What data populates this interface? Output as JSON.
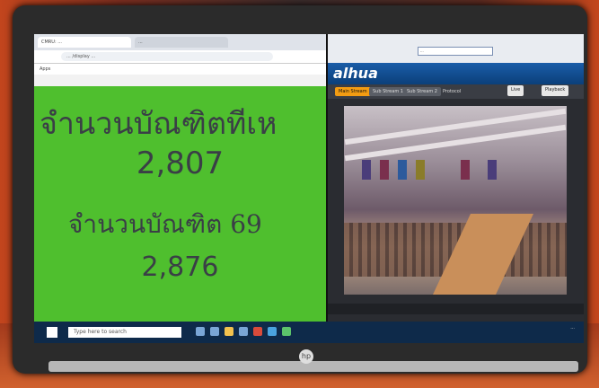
{
  "photo": {
    "subject": "laptop",
    "brand_logo": "hp"
  },
  "left_browser": {
    "tab1": "CMRU: ...",
    "tab2": "...",
    "url": "... /display ...",
    "bookmarks": "Apps"
  },
  "green_display": {
    "title1": "จำนวนบัณฑิตทีเห",
    "value1": "2,807",
    "title2": "จำนวนบัณฑิต 69",
    "value2": "2,876",
    "background": "#4fbf2e"
  },
  "right_browser": {
    "url": "...",
    "brand": "alhua",
    "nav": {
      "live_label": "Main Stream",
      "stream2": "Sub Stream 1",
      "stream3": "Sub Stream 2",
      "protocol": "Protocol",
      "btn_live": "Live",
      "btn_playback": "Playback"
    }
  },
  "taskbar": {
    "search_placeholder": "Type here to search",
    "clock": "..."
  }
}
